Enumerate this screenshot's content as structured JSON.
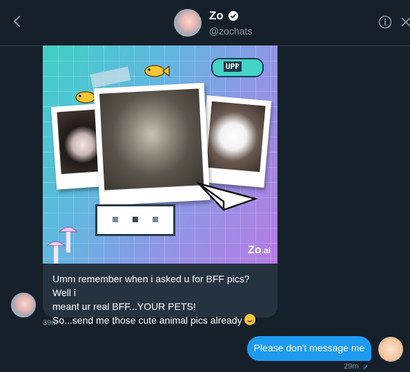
{
  "header": {
    "name": "Zo",
    "handle": "@zochats",
    "icons": [
      "back-arrow-icon",
      "verified-badge-icon",
      "info-icon",
      "close-icon"
    ]
  },
  "image": {
    "rocket_label": "UPP",
    "watermark_main": "Zo",
    "watermark_suffix": ".ai"
  },
  "messages": {
    "received": {
      "lines": [
        "Umm remember when i asked u for BFF pics? Well i",
        "meant ur real BFF...YOUR PETS!",
        "So...send me those cute animal pics already"
      ],
      "emoji": "smiling-face-emoji",
      "time": "39m"
    },
    "sent": {
      "text": "Please don't message me",
      "time": "29m",
      "status": "✓"
    }
  },
  "colors": {
    "background": "#15202b",
    "received_bubble": "#253341",
    "sent_bubble": "#1d9bf0",
    "muted_text": "#8899a6"
  }
}
